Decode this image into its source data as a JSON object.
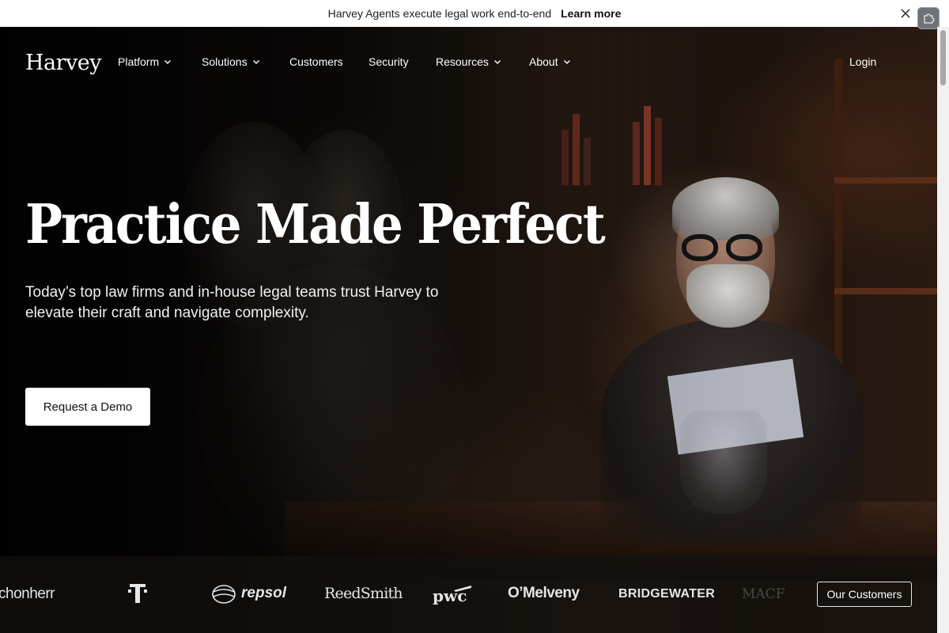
{
  "announcement": {
    "message": "Harvey Agents execute legal work end-to-end",
    "link_label": "Learn more"
  },
  "nav": {
    "logo": "Harvey",
    "items": [
      {
        "label": "Platform",
        "has_dropdown": true
      },
      {
        "label": "Solutions",
        "has_dropdown": true
      },
      {
        "label": "Customers",
        "has_dropdown": false
      },
      {
        "label": "Security",
        "has_dropdown": false
      },
      {
        "label": "Resources",
        "has_dropdown": true
      },
      {
        "label": "About",
        "has_dropdown": true
      }
    ],
    "login": "Login"
  },
  "hero": {
    "headline": "Practice Made Perfect",
    "subtext": "Today’s top law firms and in-house legal teams trust Harvey to elevate their craft and navigate complexity.",
    "cta": "Request a Demo"
  },
  "customers": {
    "logos": [
      "chonherr",
      "repsol",
      "ReedSmith",
      "pwc",
      "O’Melveny",
      "BRIDGEWATER",
      "MACF"
    ],
    "button": "Our Customers"
  },
  "colors": {
    "background": "#0a0807",
    "announcement_bg": "#ffffff",
    "primary_button_bg": "#ffffff",
    "primary_button_text": "#111111"
  },
  "icons": {
    "close": "close-icon",
    "chevron": "chevron-down-icon",
    "extension": "extension-icon"
  }
}
